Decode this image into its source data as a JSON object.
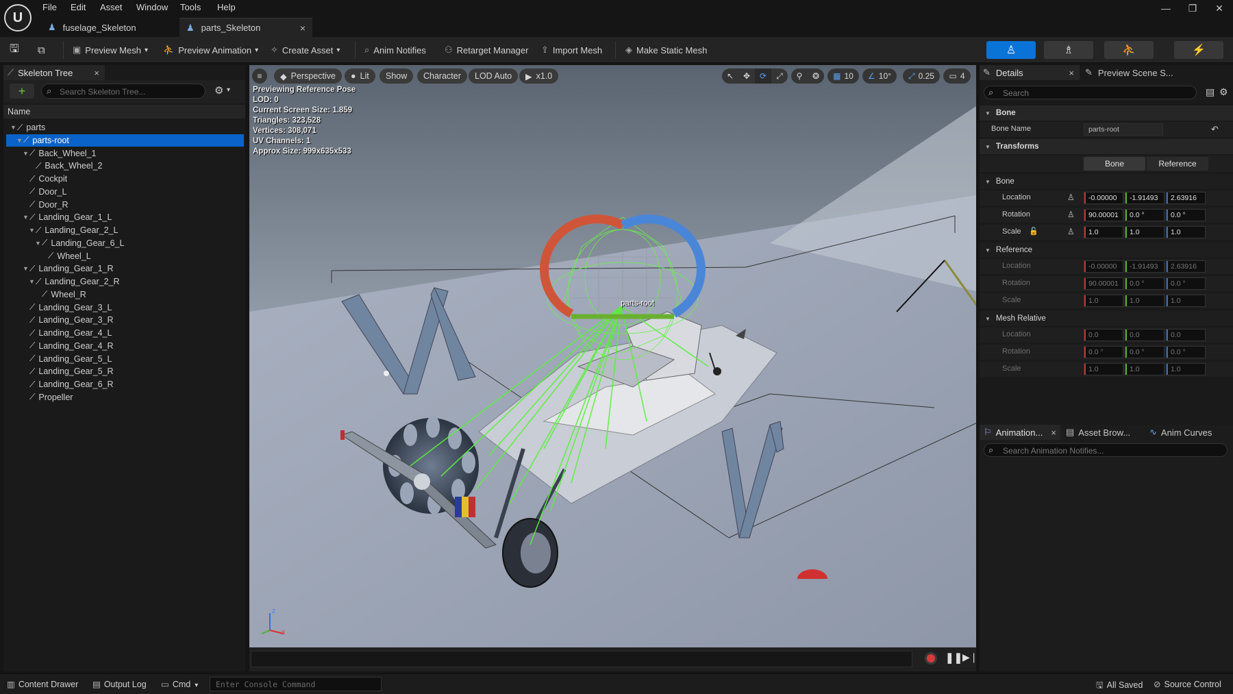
{
  "menu": [
    "File",
    "Edit",
    "Asset",
    "Window",
    "Tools",
    "Help"
  ],
  "doc_tabs": [
    {
      "label": "fuselage_Skeleton"
    },
    {
      "label": "parts_Skeleton",
      "close": "×"
    }
  ],
  "toolbar": {
    "preview_mesh": "Preview Mesh",
    "preview_animation": "Preview Animation",
    "create_asset": "Create Asset",
    "anim_notifies": "Anim Notifies",
    "retarget_manager": "Retarget Manager",
    "import_mesh": "Import Mesh",
    "make_static_mesh": "Make Static Mesh"
  },
  "skeleton_tree": {
    "tab_label": "Skeleton Tree",
    "close": "×",
    "search_placeholder": "Search Skeleton Tree...",
    "column_name": "Name",
    "rows": [
      {
        "label": "parts",
        "depth": 0,
        "expanded": true
      },
      {
        "label": "parts-root",
        "depth": 1,
        "expanded": true,
        "selected": true
      },
      {
        "label": "Back_Wheel_1",
        "depth": 2,
        "expanded": true
      },
      {
        "label": "Back_Wheel_2",
        "depth": 3
      },
      {
        "label": "Cockpit",
        "depth": 2
      },
      {
        "label": "Door_L",
        "depth": 2
      },
      {
        "label": "Door_R",
        "depth": 2
      },
      {
        "label": "Landing_Gear_1_L",
        "depth": 2,
        "expanded": true
      },
      {
        "label": "Landing_Gear_2_L",
        "depth": 3,
        "expanded": true
      },
      {
        "label": "Landing_Gear_6_L",
        "depth": 4,
        "expanded": true
      },
      {
        "label": "Wheel_L",
        "depth": 5
      },
      {
        "label": "Landing_Gear_1_R",
        "depth": 2,
        "expanded": true
      },
      {
        "label": "Landing_Gear_2_R",
        "depth": 3,
        "expanded": true
      },
      {
        "label": "Wheel_R",
        "depth": 4
      },
      {
        "label": "Landing_Gear_3_L",
        "depth": 2
      },
      {
        "label": "Landing_Gear_3_R",
        "depth": 2
      },
      {
        "label": "Landing_Gear_4_L",
        "depth": 2
      },
      {
        "label": "Landing_Gear_4_R",
        "depth": 2
      },
      {
        "label": "Landing_Gear_5_L",
        "depth": 2
      },
      {
        "label": "Landing_Gear_5_R",
        "depth": 2
      },
      {
        "label": "Landing_Gear_6_R",
        "depth": 2
      },
      {
        "label": "Propeller",
        "depth": 2
      }
    ]
  },
  "viewport": {
    "perspective": "Perspective",
    "lit": "Lit",
    "show": "Show",
    "character": "Character",
    "lod": "LOD Auto",
    "speed": "x1.0",
    "grid_snap": "10",
    "rot_snap": "10°",
    "scale_snap": "0.25",
    "camera_speed": "4",
    "stats": [
      "Previewing Reference Pose",
      "LOD: 0",
      "Current Screen Size: 1.859",
      "Triangles: 323,528",
      "Vertices: 308,071",
      "UV Channels: 1",
      "Approx Size: 999x635x533"
    ],
    "bone_label": "parts-root",
    "axis_x": "x",
    "axis_z": "z"
  },
  "details": {
    "tab_label": "Details",
    "close": "×",
    "preview_tab": "Preview Scene S...",
    "search_placeholder": "Search",
    "bone_section": "Bone",
    "bone_name_label": "Bone Name",
    "bone_name_value": "parts-root",
    "transforms_section": "Transforms",
    "toggle_bone": "Bone",
    "toggle_reference": "Reference",
    "bone_sub": "Bone",
    "reference_sub": "Reference",
    "mesh_relative_sub": "Mesh Relative",
    "labels": {
      "location": "Location",
      "rotation": "Rotation",
      "scale": "Scale"
    },
    "bone": {
      "location": [
        "-0.00000",
        "-1.91493",
        "2.63916"
      ],
      "rotation": [
        "90.00001",
        "0.0 °",
        "0.0 °"
      ],
      "scale": [
        "1.0",
        "1.0",
        "1.0"
      ]
    },
    "reference": {
      "location": [
        "-0.00000",
        "-1.91493",
        "2.63916"
      ],
      "rotation": [
        "90.00001",
        "0.0 °",
        "0.0 °"
      ],
      "scale": [
        "1.0",
        "1.0",
        "1.0"
      ]
    },
    "mesh_relative": {
      "location": [
        "0.0",
        "0.0",
        "0.0"
      ],
      "rotation": [
        "0.0 °",
        "0.0 °",
        "0.0 °"
      ],
      "scale": [
        "1.0",
        "1.0",
        "1.0"
      ]
    }
  },
  "anim_panel": {
    "tab_animation": "Animation...",
    "close": "×",
    "tab_asset_browser": "Asset Brow...",
    "tab_anim_curves": "Anim Curves",
    "search_placeholder": "Search Animation Notifies..."
  },
  "statusbar": {
    "content_drawer": "Content Drawer",
    "output_log": "Output Log",
    "cmd": "Cmd",
    "console_placeholder": "Enter Console Command",
    "all_saved": "All Saved",
    "source_control": "Source Control"
  },
  "colors": {
    "accent": "#0a73d8",
    "selection": "#0a63c8",
    "x_axis": "#c83030",
    "y_axis": "#5ab030",
    "z_axis": "#3070d0"
  }
}
